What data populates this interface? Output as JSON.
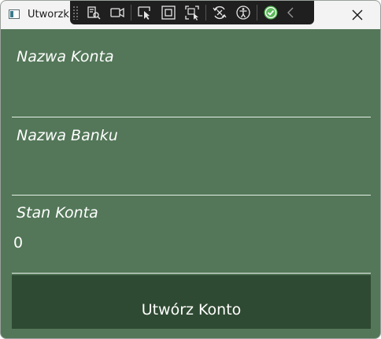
{
  "window": {
    "title": "Utworzk",
    "close_glyph": "✕"
  },
  "dev_toolbar": {
    "tools": [
      "live-visual-tree-icon",
      "record-icon",
      "select-element-icon",
      "display-layout-adorners-icon",
      "track-focus-icon",
      "hot-reload-icon",
      "accessibility-icon",
      "accessibility-checker-icon",
      "collapse-chevron-icon"
    ]
  },
  "form": {
    "account_name_label": "Nazwa Konta",
    "account_name_value": "",
    "bank_name_label": "Nazwa Banku",
    "bank_name_value": "",
    "balance_label": "Stan Konta",
    "balance_value": "0",
    "submit_label": "Utwórz Konto"
  },
  "colors": {
    "background": "#537758",
    "button": "#2f4a32",
    "text": "#ffffff"
  }
}
